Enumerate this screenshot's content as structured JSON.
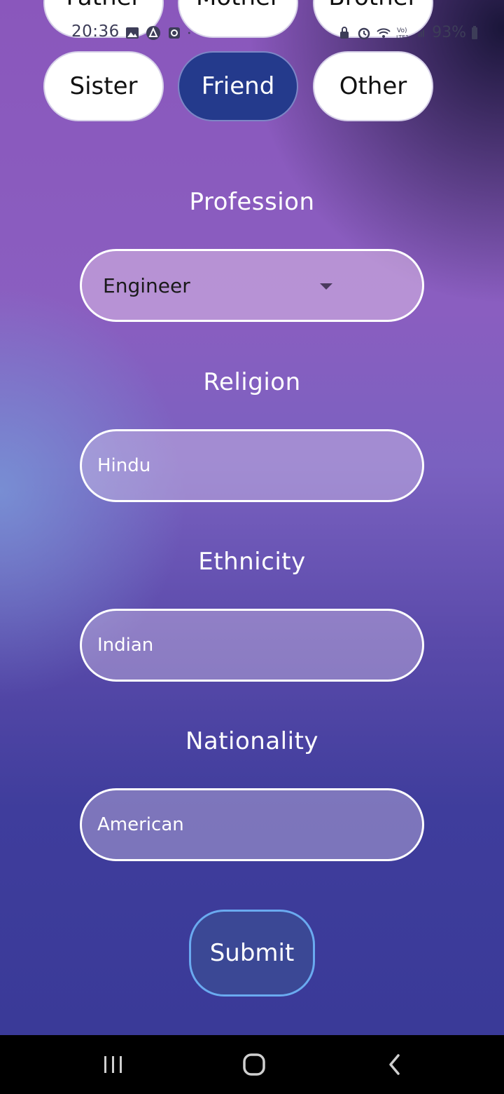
{
  "status_bar": {
    "time": "20:36",
    "battery": "93%",
    "icons_left": [
      "gallery-icon",
      "app-icon",
      "camera-icon",
      "dot-icon"
    ],
    "icons_right": [
      "lock-icon",
      "alarm-icon",
      "wifi-icon",
      "volte-icon",
      "signal-icon",
      "battery-icon"
    ]
  },
  "relations": {
    "row1": [
      "Father",
      "Mother",
      "Brother"
    ],
    "row2": [
      "Sister",
      "Friend",
      "Other"
    ],
    "selected": "Friend"
  },
  "form": {
    "profession": {
      "label": "Profession",
      "value": "Engineer"
    },
    "religion": {
      "label": "Religion",
      "value": "Hindu"
    },
    "ethnicity": {
      "label": "Ethnicity",
      "value": "Indian"
    },
    "nationality": {
      "label": "Nationality",
      "value": "American"
    }
  },
  "submit_label": "Submit",
  "nav_bar": [
    "recents-icon",
    "home-icon",
    "back-icon"
  ],
  "colors": {
    "selected_chip": "#243a8c",
    "submit_bg": "#3b4895",
    "submit_border": "#6aaaf0"
  }
}
